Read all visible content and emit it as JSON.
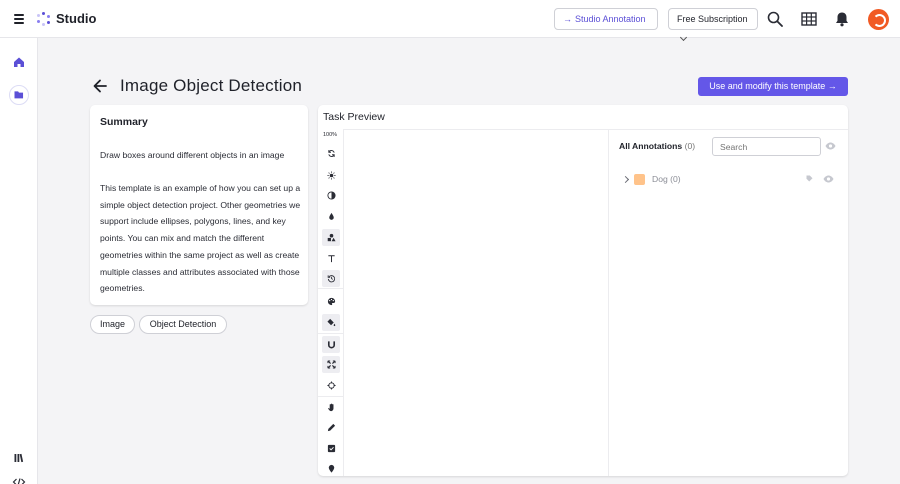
{
  "app": {
    "brand": "Studio"
  },
  "topbar": {
    "studio_annotation_label": "Studio Annotation",
    "subscription_label": "Free Subscription",
    "icons": [
      "menu-icon",
      "search-icon",
      "apps-grid-icon",
      "bell-icon",
      "avatar"
    ],
    "accent_color": "#6457e8",
    "avatar_color": "#f15a24"
  },
  "rail": {
    "icons": [
      "home-icon",
      "folder-icon",
      "library-icon",
      "code-icon"
    ]
  },
  "header": {
    "title": "Image Object Detection",
    "primary_button": "Use and modify this template →"
  },
  "summary": {
    "title": "Summary",
    "description": "Draw boxes around different objects in an image",
    "body": "This template is an example of how you can set up a simple object detection project. Other geometries we support include ellipses, polygons, lines, and key points. You can mix and match the different geometries within the same project as well as create multiple classes and attributes associated with those geometries."
  },
  "tags": [
    "Image",
    "Object Detection"
  ],
  "preview": {
    "title": "Task Preview",
    "zoom": "100%",
    "tools": [
      "rotate-icon",
      "brightness-icon",
      "contrast-icon",
      "saturation-icon",
      "shapes-icon",
      "text-icon",
      "history-icon",
      "palette-icon",
      "fill-icon",
      "magnet-icon",
      "expand-icon",
      "crosshair-icon",
      "hand-icon",
      "pen-icon",
      "checkbox-icon",
      "keypoint-icon"
    ],
    "annotations_title": "All Annotations",
    "annotations_count": "(0)",
    "search_placeholder": "Search",
    "classes": [
      {
        "name": "Dog",
        "count": "(0)",
        "color": "#ffc38a"
      }
    ]
  }
}
